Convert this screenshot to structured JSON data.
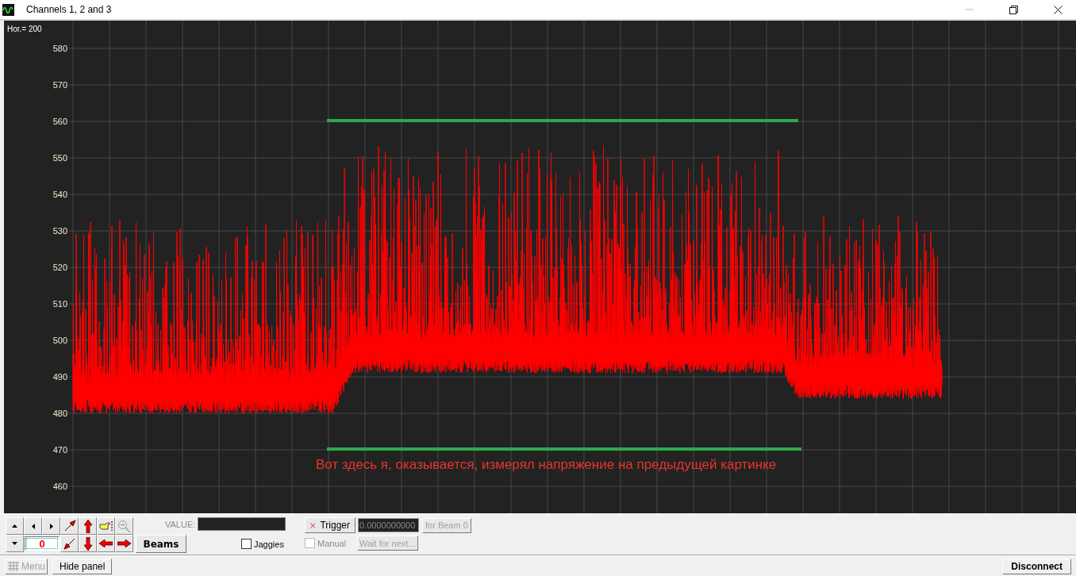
{
  "window": {
    "title": "Channels 1, 2 and 3"
  },
  "plot": {
    "corner_label": "Hor.= 200",
    "y_ticks": [
      "580",
      "570",
      "560",
      "550",
      "540",
      "530",
      "520",
      "510",
      "500",
      "490",
      "480",
      "470",
      "460"
    ],
    "annotation": "Вот здесь я, оказывается, измерял напряжение на предыдущей картинке"
  },
  "panel": {
    "beam_counter": "0",
    "beams_button": "Beams",
    "value_label": "VALUE:",
    "jaggies": {
      "label": "Jaggies",
      "checked": false
    },
    "trigger_button": "Trigger",
    "trigger_value": "0.0000000000",
    "for_beam_button": {
      "label": "for Beam 0",
      "disabled": true
    },
    "manual": {
      "label": "Manual",
      "checked": false,
      "disabled": true
    },
    "wait_button": {
      "label": "Wait for next...",
      "disabled": true
    }
  },
  "bottom_bar": {
    "menu_button": {
      "label": "Menu",
      "disabled": true
    },
    "hide_panel_button": "Hide panel",
    "disconnect_button": "Disconnect"
  }
}
